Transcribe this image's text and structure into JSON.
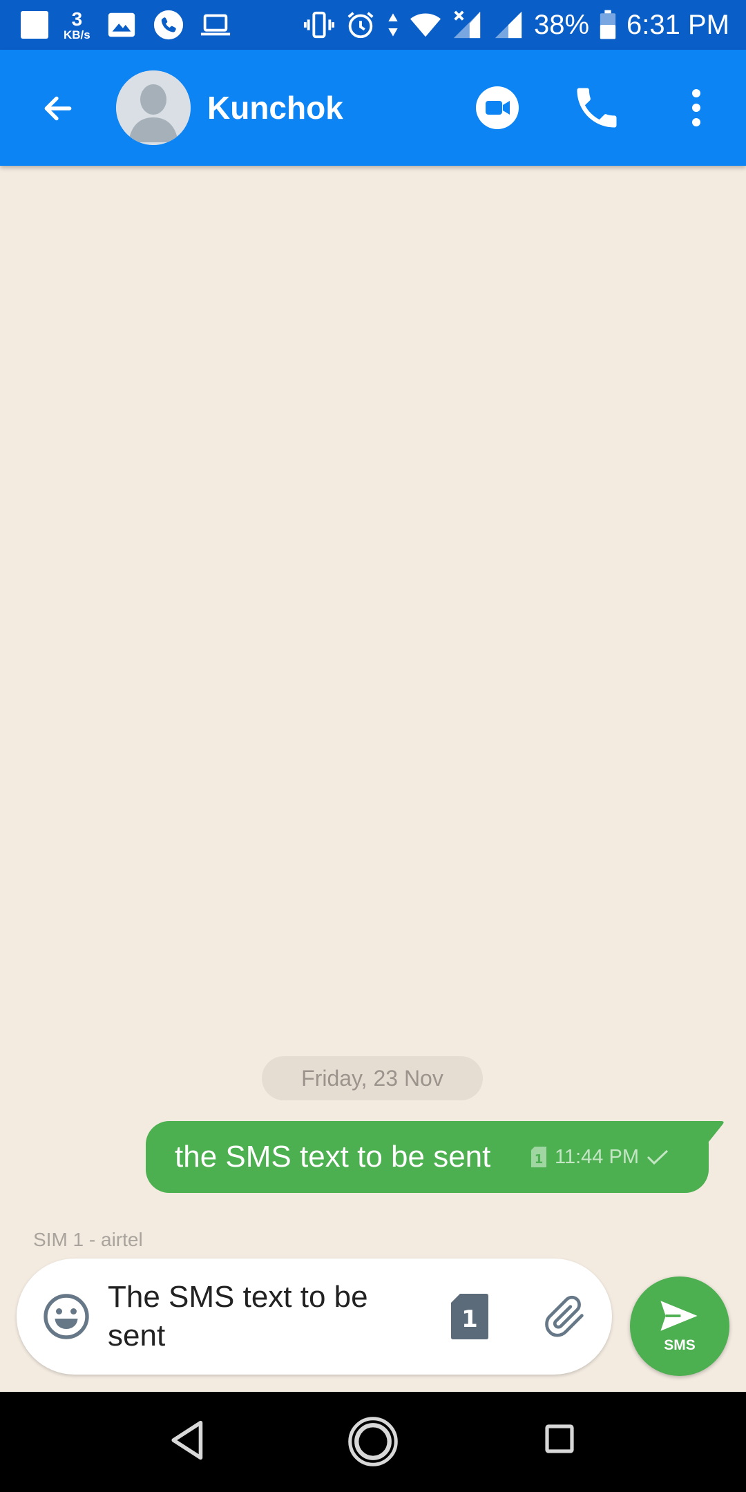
{
  "status_bar": {
    "net_speed_value": "3",
    "net_speed_unit": "KB/s",
    "battery": "38%",
    "time": "6:31 PM",
    "icons": [
      "notification-square-icon",
      "image-icon",
      "phone-call-icon",
      "laptop-icon",
      "vibrate-icon",
      "alarm-icon",
      "data-arrows-icon",
      "wifi-icon",
      "signal-x-icon",
      "signal-icon",
      "battery-icon"
    ]
  },
  "app_bar": {
    "contact_name": "Kunchok",
    "icons": [
      "back-arrow-icon",
      "avatar-icon",
      "video-call-icon",
      "phone-icon",
      "more-vert-icon"
    ],
    "color": "#0c84f4"
  },
  "conversation": {
    "date_label": "Friday, 23 Nov",
    "messages": [
      {
        "text": "the SMS text to be sent",
        "time": "11:44 PM",
        "sim": "1",
        "status": "sent",
        "direction": "outgoing"
      }
    ]
  },
  "composer": {
    "sim_label": "SIM 1 - airtel",
    "input_value": "The SMS text to be sent",
    "sim_button_label": "1",
    "send_label": "SMS",
    "send_color": "#4caf50"
  },
  "nav_bar": {
    "icons": [
      "nav-back-icon",
      "nav-home-icon",
      "nav-recents-icon"
    ]
  }
}
